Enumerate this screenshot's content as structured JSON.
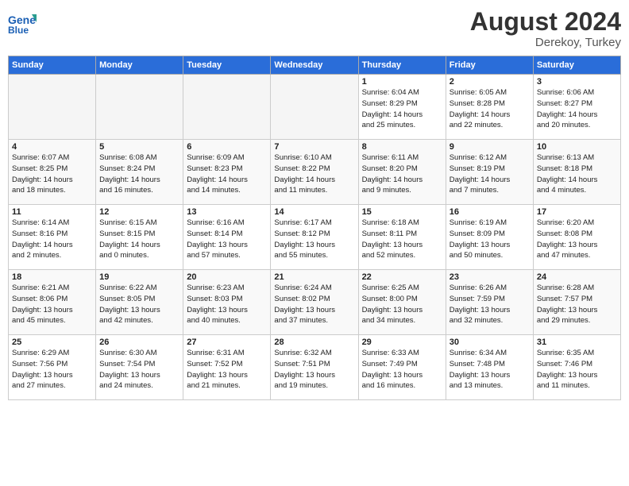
{
  "header": {
    "logo_line1": "General",
    "logo_line2": "Blue",
    "month_year": "August 2024",
    "location": "Derekoy, Turkey"
  },
  "days_of_week": [
    "Sunday",
    "Monday",
    "Tuesday",
    "Wednesday",
    "Thursday",
    "Friday",
    "Saturday"
  ],
  "weeks": [
    [
      {
        "day": "",
        "data": ""
      },
      {
        "day": "",
        "data": ""
      },
      {
        "day": "",
        "data": ""
      },
      {
        "day": "",
        "data": ""
      },
      {
        "day": "1",
        "data": "Sunrise: 6:04 AM\nSunset: 8:29 PM\nDaylight: 14 hours\nand 25 minutes."
      },
      {
        "day": "2",
        "data": "Sunrise: 6:05 AM\nSunset: 8:28 PM\nDaylight: 14 hours\nand 22 minutes."
      },
      {
        "day": "3",
        "data": "Sunrise: 6:06 AM\nSunset: 8:27 PM\nDaylight: 14 hours\nand 20 minutes."
      }
    ],
    [
      {
        "day": "4",
        "data": "Sunrise: 6:07 AM\nSunset: 8:25 PM\nDaylight: 14 hours\nand 18 minutes."
      },
      {
        "day": "5",
        "data": "Sunrise: 6:08 AM\nSunset: 8:24 PM\nDaylight: 14 hours\nand 16 minutes."
      },
      {
        "day": "6",
        "data": "Sunrise: 6:09 AM\nSunset: 8:23 PM\nDaylight: 14 hours\nand 14 minutes."
      },
      {
        "day": "7",
        "data": "Sunrise: 6:10 AM\nSunset: 8:22 PM\nDaylight: 14 hours\nand 11 minutes."
      },
      {
        "day": "8",
        "data": "Sunrise: 6:11 AM\nSunset: 8:20 PM\nDaylight: 14 hours\nand 9 minutes."
      },
      {
        "day": "9",
        "data": "Sunrise: 6:12 AM\nSunset: 8:19 PM\nDaylight: 14 hours\nand 7 minutes."
      },
      {
        "day": "10",
        "data": "Sunrise: 6:13 AM\nSunset: 8:18 PM\nDaylight: 14 hours\nand 4 minutes."
      }
    ],
    [
      {
        "day": "11",
        "data": "Sunrise: 6:14 AM\nSunset: 8:16 PM\nDaylight: 14 hours\nand 2 minutes."
      },
      {
        "day": "12",
        "data": "Sunrise: 6:15 AM\nSunset: 8:15 PM\nDaylight: 14 hours\nand 0 minutes."
      },
      {
        "day": "13",
        "data": "Sunrise: 6:16 AM\nSunset: 8:14 PM\nDaylight: 13 hours\nand 57 minutes."
      },
      {
        "day": "14",
        "data": "Sunrise: 6:17 AM\nSunset: 8:12 PM\nDaylight: 13 hours\nand 55 minutes."
      },
      {
        "day": "15",
        "data": "Sunrise: 6:18 AM\nSunset: 8:11 PM\nDaylight: 13 hours\nand 52 minutes."
      },
      {
        "day": "16",
        "data": "Sunrise: 6:19 AM\nSunset: 8:09 PM\nDaylight: 13 hours\nand 50 minutes."
      },
      {
        "day": "17",
        "data": "Sunrise: 6:20 AM\nSunset: 8:08 PM\nDaylight: 13 hours\nand 47 minutes."
      }
    ],
    [
      {
        "day": "18",
        "data": "Sunrise: 6:21 AM\nSunset: 8:06 PM\nDaylight: 13 hours\nand 45 minutes."
      },
      {
        "day": "19",
        "data": "Sunrise: 6:22 AM\nSunset: 8:05 PM\nDaylight: 13 hours\nand 42 minutes."
      },
      {
        "day": "20",
        "data": "Sunrise: 6:23 AM\nSunset: 8:03 PM\nDaylight: 13 hours\nand 40 minutes."
      },
      {
        "day": "21",
        "data": "Sunrise: 6:24 AM\nSunset: 8:02 PM\nDaylight: 13 hours\nand 37 minutes."
      },
      {
        "day": "22",
        "data": "Sunrise: 6:25 AM\nSunset: 8:00 PM\nDaylight: 13 hours\nand 34 minutes."
      },
      {
        "day": "23",
        "data": "Sunrise: 6:26 AM\nSunset: 7:59 PM\nDaylight: 13 hours\nand 32 minutes."
      },
      {
        "day": "24",
        "data": "Sunrise: 6:28 AM\nSunset: 7:57 PM\nDaylight: 13 hours\nand 29 minutes."
      }
    ],
    [
      {
        "day": "25",
        "data": "Sunrise: 6:29 AM\nSunset: 7:56 PM\nDaylight: 13 hours\nand 27 minutes."
      },
      {
        "day": "26",
        "data": "Sunrise: 6:30 AM\nSunset: 7:54 PM\nDaylight: 13 hours\nand 24 minutes."
      },
      {
        "day": "27",
        "data": "Sunrise: 6:31 AM\nSunset: 7:52 PM\nDaylight: 13 hours\nand 21 minutes."
      },
      {
        "day": "28",
        "data": "Sunrise: 6:32 AM\nSunset: 7:51 PM\nDaylight: 13 hours\nand 19 minutes."
      },
      {
        "day": "29",
        "data": "Sunrise: 6:33 AM\nSunset: 7:49 PM\nDaylight: 13 hours\nand 16 minutes."
      },
      {
        "day": "30",
        "data": "Sunrise: 6:34 AM\nSunset: 7:48 PM\nDaylight: 13 hours\nand 13 minutes."
      },
      {
        "day": "31",
        "data": "Sunrise: 6:35 AM\nSunset: 7:46 PM\nDaylight: 13 hours\nand 11 minutes."
      }
    ]
  ]
}
